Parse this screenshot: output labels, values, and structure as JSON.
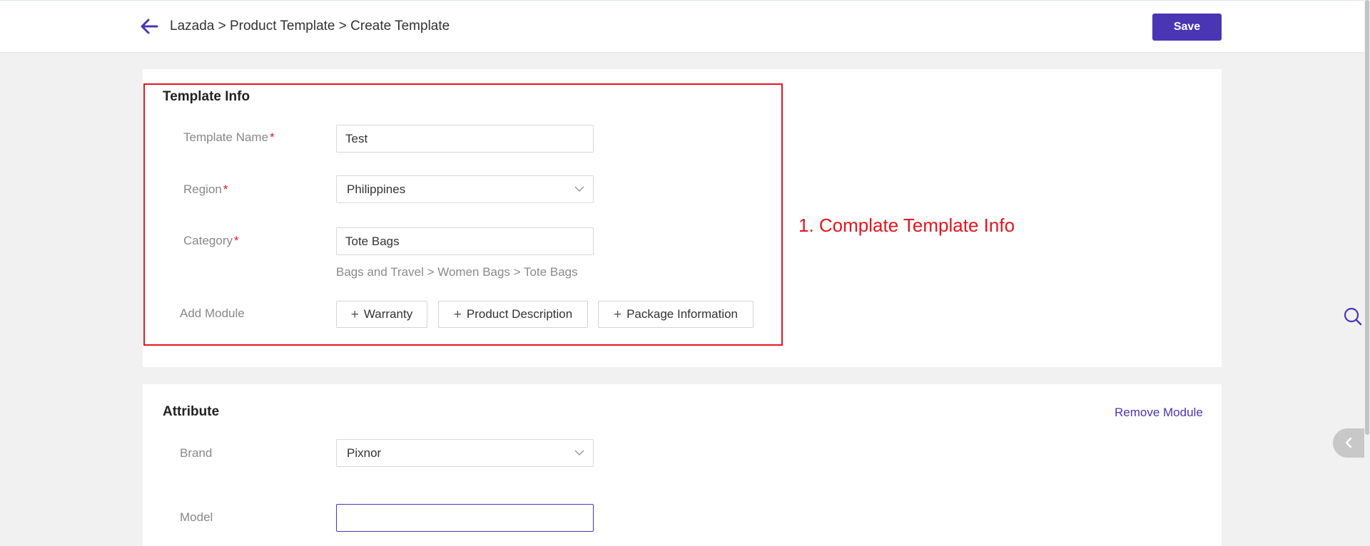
{
  "header": {
    "breadcrumb": "Lazada > Product Template > Create Template",
    "save_label": "Save"
  },
  "template_info": {
    "title": "Template Info",
    "fields": {
      "template_name": {
        "label": "Template Name",
        "required_mark": "*",
        "value": "Test"
      },
      "region": {
        "label": "Region",
        "required_mark": "*",
        "value": "Philippines"
      },
      "category": {
        "label": "Category",
        "required_mark": "*",
        "value": "Tote Bags",
        "path": "Bags and Travel > Women Bags > Tote Bags"
      }
    },
    "add_module": {
      "label": "Add Module",
      "buttons": [
        "Warranty",
        "Product Description",
        "Package Information"
      ]
    }
  },
  "annotation": {
    "text": "1. Complate Template Info",
    "color": "#e5141c"
  },
  "attribute": {
    "title": "Attribute",
    "remove_label": "Remove Module",
    "fields": {
      "brand": {
        "label": "Brand",
        "value": "Pixnor"
      },
      "model": {
        "label": "Model",
        "value": ""
      }
    }
  },
  "icons": {
    "back": "arrow-left-icon",
    "dropdown": "chevron-down-icon",
    "plus": "plus-icon",
    "search": "search-icon",
    "collapse": "chevron-left-icon"
  },
  "colors": {
    "accent": "#4a35b4",
    "annotation": "#e5141c",
    "background": "#f1f1f1"
  }
}
